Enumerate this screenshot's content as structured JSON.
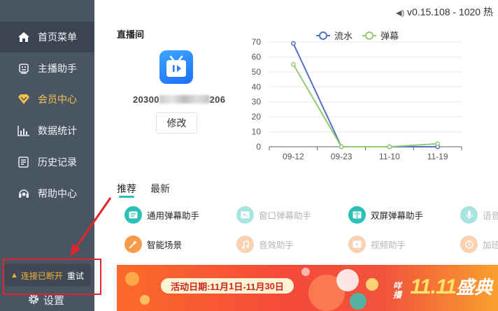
{
  "app": {
    "version": "v0.15.108 - 1020 热"
  },
  "sidebar": {
    "items": [
      {
        "label": "首页菜单",
        "icon": "home-icon",
        "active": true
      },
      {
        "label": "主播助手",
        "icon": "robot-icon"
      },
      {
        "label": "会员中心",
        "icon": "diamond-icon",
        "highlight": "#f3c24a"
      },
      {
        "label": "数据统计",
        "icon": "bar-chart-icon"
      },
      {
        "label": "历史记录",
        "icon": "history-icon"
      },
      {
        "label": "帮助中心",
        "icon": "headset-icon"
      }
    ],
    "status": {
      "disconnected": "连接已断开",
      "retry": "重试"
    },
    "settings_label": "设置"
  },
  "room": {
    "title": "直播间",
    "id_prefix": "20300",
    "id_suffix": "206",
    "edit_label": "修改"
  },
  "chart_data": {
    "type": "line",
    "x": [
      "09-12",
      "09-23",
      "11-10",
      "11-19"
    ],
    "series": [
      {
        "name": "流水",
        "values": [
          69,
          0,
          0,
          0
        ],
        "color": "#5470c6"
      },
      {
        "name": "弹幕",
        "values": [
          55,
          0,
          0,
          2
        ],
        "color": "#91cc75"
      }
    ],
    "ylim": [
      0,
      70
    ],
    "yticks": [
      0,
      10,
      20,
      30,
      40,
      50,
      60,
      70
    ],
    "grid": true,
    "legend": "top"
  },
  "tabs": {
    "recommend": "推荐",
    "latest": "最新"
  },
  "tools": [
    {
      "label": "通用弹幕助手",
      "icon": "message-icon"
    },
    {
      "label": "窗口弹幕助手",
      "icon": "window-icon"
    },
    {
      "label": "双屏弹幕助手",
      "icon": "dual-screen-icon"
    },
    {
      "label": "语音",
      "icon": "voice-icon"
    },
    {
      "label": "智能场景",
      "icon": "magic-wand-icon"
    },
    {
      "label": "音效助手",
      "icon": "music-icon"
    },
    {
      "label": "视频助手",
      "icon": "video-icon"
    },
    {
      "label": "加班",
      "icon": "clock-icon"
    }
  ],
  "banner": {
    "date_prefix": "活动日期:11月",
    "d1": "1",
    "date_mid": "日-11月",
    "d2": "30",
    "date_suffix": "日",
    "brand_small": "咩播",
    "brand_big": "11.11",
    "brand_cn": "盛典"
  }
}
